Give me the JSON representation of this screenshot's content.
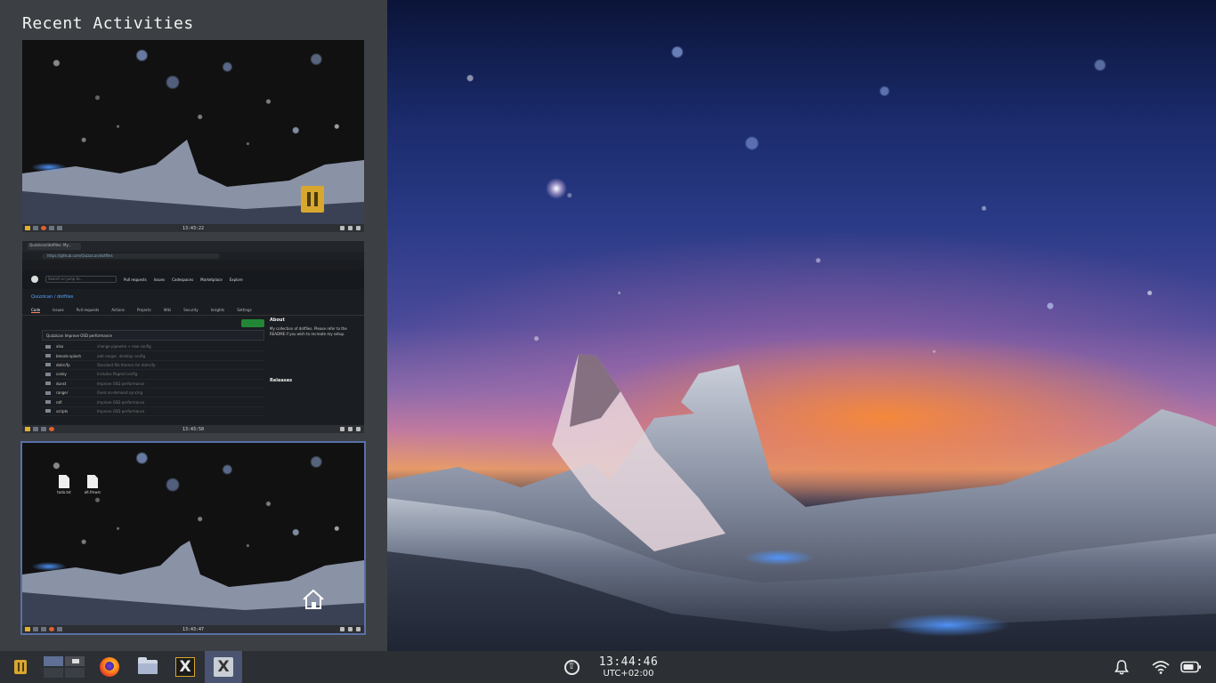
{
  "activities": {
    "title": "Recent Activities",
    "thumbnails": [
      {
        "kind": "desktop-wallpaper",
        "clock": "13:43:22"
      },
      {
        "kind": "browser-github",
        "clock": "13:43:50",
        "tab_title": "Quizzican/dotfiles: My...",
        "url": "https://github.com/Quizzican/dotfiles",
        "header_links": [
          "Pull requests",
          "Issues",
          "Codespaces",
          "Marketplace",
          "Explore"
        ],
        "search_placeholder": "Search or jump to...",
        "repo": "Quizzican / dotfiles",
        "repo_tabs": [
          "Code",
          "Issues",
          "Pull requests",
          "Actions",
          "Projects",
          "Wiki",
          "Security",
          "Insights",
          "Settings"
        ],
        "latest_commit": "Quizzican Improve OSD performance",
        "files": [
          {
            "name": "alsa",
            "msg": "change pipewire + new config"
          },
          {
            "name": "bmonk-splash",
            "msg": "add ranger, desktop config"
          },
          {
            "name": "dotrc/fp",
            "msg": "Standard file themes for dotrc/fp"
          },
          {
            "name": "conky",
            "msg": "Includes Pkgmd config"
          },
          {
            "name": "dunst",
            "msg": "Improve OSD performance"
          },
          {
            "name": "ranger",
            "msg": "Fixed on-demand syncing"
          },
          {
            "name": "rofi",
            "msg": "Improve OSD performance"
          },
          {
            "name": "scripts",
            "msg": "Improve OSD performance"
          }
        ],
        "about_title": "About",
        "about_text": "My collection of dotfiles. Please refer to the README if you wish to recreate my setup.",
        "releases_title": "Releases"
      },
      {
        "kind": "desktop-icons",
        "clock": "13:43:47",
        "icons": [
          {
            "label": "todo.txt"
          },
          {
            "label": "alt.fmwrc"
          }
        ]
      }
    ]
  },
  "taskbar": {
    "apps": [
      {
        "name": "menu",
        "icon": "app-menu-icon"
      },
      {
        "name": "pager",
        "icon": "workspace-pager"
      },
      {
        "name": "firefox",
        "icon": "firefox-icon"
      },
      {
        "name": "files",
        "icon": "folder-icon"
      },
      {
        "name": "window-1",
        "icon": "terminal-app-icon",
        "glyph": "X"
      },
      {
        "name": "window-2",
        "icon": "app-x-icon",
        "glyph": "X"
      }
    ],
    "clock": {
      "time": "13:44:46",
      "timezone": "UTC+02:00"
    },
    "tray": [
      "upload-icon",
      "bell-icon",
      "wifi-icon",
      "battery-icon"
    ]
  },
  "colors": {
    "panel_bg": "#3c4044",
    "taskbar_bg": "#2c2f33",
    "accent_yellow": "#d7a72e",
    "active_window_bg": "#4a5470",
    "selected_thumb_border": "#5b6fa8"
  }
}
